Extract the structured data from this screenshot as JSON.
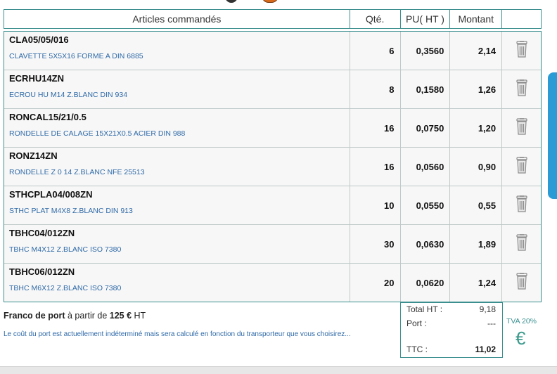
{
  "table": {
    "headers": {
      "articles": "Articles commandés",
      "qte": "Qté.",
      "pu": "PU( HT )",
      "montant": "Montant"
    },
    "rows": [
      {
        "code": "CLA05/05/016",
        "desc": "CLAVETTE 5X5X16 FORME A DIN 6885",
        "qte": "6",
        "pu": "0,3560",
        "montant": "2,14"
      },
      {
        "code": "ECRHU14ZN",
        "desc": "ECROU HU M14 Z.BLANC DIN 934",
        "qte": "8",
        "pu": "0,1580",
        "montant": "1,26"
      },
      {
        "code": "RONCAL15/21/0.5",
        "desc": "RONDELLE DE CALAGE 15X21X0.5 ACIER DIN 988",
        "qte": "16",
        "pu": "0,0750",
        "montant": "1,20"
      },
      {
        "code": "RONZ14ZN",
        "desc": "RONDELLE Z 0 14 Z.BLANC NFE 25513",
        "qte": "16",
        "pu": "0,0560",
        "montant": "0,90"
      },
      {
        "code": "STHCPLA04/008ZN",
        "desc": "STHC PLAT M4X8 Z.BLANC DIN 913",
        "qte": "10",
        "pu": "0,0550",
        "montant": "0,55"
      },
      {
        "code": "TBHC04/012ZN",
        "desc": "TBHC M4X12 Z.BLANC ISO 7380",
        "qte": "30",
        "pu": "0,0630",
        "montant": "1,89"
      },
      {
        "code": "TBHC06/012ZN",
        "desc": "TBHC M6X12 Z.BLANC ISO 7380",
        "qte": "20",
        "pu": "0,0620",
        "montant": "1,24"
      }
    ],
    "delete_icon": "trash-icon"
  },
  "shipping": {
    "franco_bold": "Franco de port",
    "franco_mid": " à partir de ",
    "franco_amount": "125 €",
    "franco_end": " HT",
    "note": "Le coût du port est actuellement indéterminé mais sera calculé en fonction du transporteur que vous choisirez..."
  },
  "totals": {
    "total_ht_label": "Total HT :",
    "total_ht_value": "9,18",
    "port_label": "Port :",
    "port_value": "---",
    "ttc_label": "TTC :",
    "ttc_value": "11,02"
  },
  "tva": {
    "label": "TVA 20%",
    "currency_symbol": "€"
  },
  "colors": {
    "border": "#3b8f8f",
    "link_blue": "#2f6aa8",
    "side_tab": "#2b9bd6"
  }
}
